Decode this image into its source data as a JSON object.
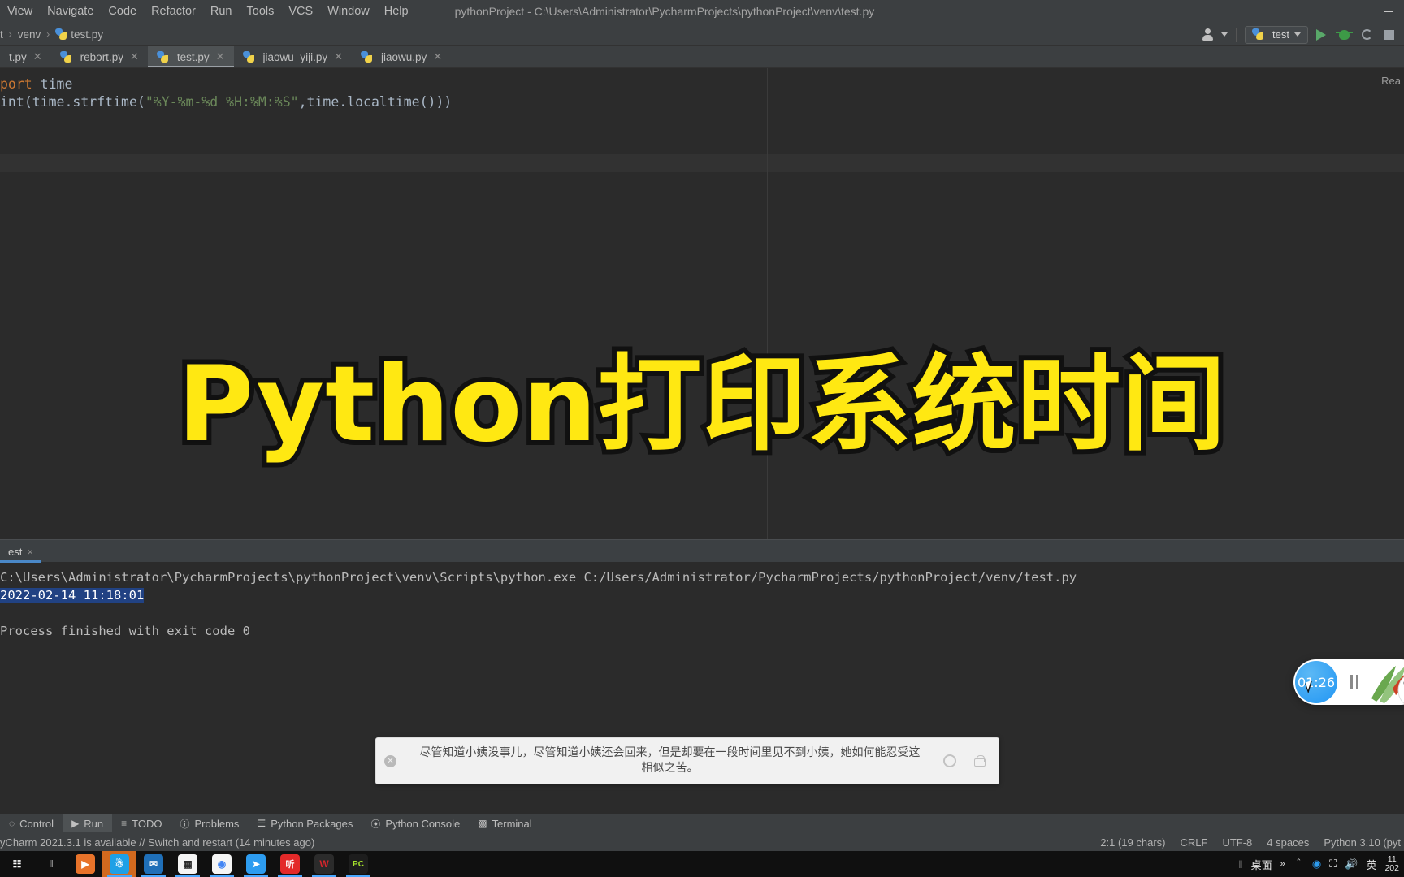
{
  "menubar": {
    "items": [
      "View",
      "Navigate",
      "Code",
      "Refactor",
      "Run",
      "Tools",
      "VCS",
      "Window",
      "Help"
    ],
    "window_title": "pythonProject - C:\\Users\\Administrator\\PycharmProjects\\pythonProject\\venv\\test.py"
  },
  "breadcrumb": {
    "project_fragment": "t",
    "folder": "venv",
    "file": "test.py",
    "separator": "›"
  },
  "toolbar": {
    "run_config_label": "test",
    "user_icon": "user-icon",
    "run_icon": "run-icon",
    "debug_icon": "debug-icon",
    "coverage_icon": "coverage-icon",
    "stop_icon": "stop-icon"
  },
  "tabs": [
    {
      "label": "t.py",
      "active": false
    },
    {
      "label": "rebort.py",
      "active": false
    },
    {
      "label": "test.py",
      "active": true
    },
    {
      "label": "jiaowu_yiji.py",
      "active": false
    },
    {
      "label": "jiaowu.py",
      "active": false
    }
  ],
  "editor": {
    "reader_mode_label": "Rea",
    "line1": {
      "kw": "port",
      "rest": " time"
    },
    "line2": {
      "fn": "int",
      "p1": "(",
      "a1": "time.strftime(",
      "str": "\"%Y-%m-%d %H:%M:%S\"",
      "a2": ",time.localtime()",
      "p2": "))"
    }
  },
  "overlay": {
    "title": "Python打印系统时间"
  },
  "run_window": {
    "tab_label": "est",
    "close_label": "×",
    "command_line": "C:\\Users\\Administrator\\PycharmProjects\\pythonProject\\venv\\Scripts\\python.exe C:/Users/Administrator/PycharmProjects/pythonProject/venv/test.py",
    "output_line": "2022-02-14 11:18:01",
    "exit_line": "Process finished with exit code 0"
  },
  "tool_strip": {
    "items": [
      {
        "label": "Control",
        "icon": "version-control-icon",
        "active": false
      },
      {
        "label": "Run",
        "icon": "run-icon",
        "active": true
      },
      {
        "label": "TODO",
        "icon": "todo-icon",
        "active": false
      },
      {
        "label": "Problems",
        "icon": "problems-icon",
        "active": false
      },
      {
        "label": "Python Packages",
        "icon": "packages-icon",
        "active": false
      },
      {
        "label": "Python Console",
        "icon": "python-console-icon",
        "active": false
      },
      {
        "label": "Terminal",
        "icon": "terminal-icon",
        "active": false
      }
    ]
  },
  "status_bar": {
    "message": "yCharm 2021.3.1 is available // Switch and restart (14 minutes ago)",
    "caret_position": "2:1 (19 chars)",
    "line_separator": "CRLF",
    "encoding": "UTF-8",
    "indent": "4 spaces",
    "interpreter": "Python 3.10 (pyt"
  },
  "ime_popup": {
    "text": "尽管知道小姨没事儿，尽管知道小姨还会回来，但是却要在一段时间里见不到小姨，她如何能忍受这相似之苦。",
    "close_label": "✕"
  },
  "timer_widget": {
    "time": "01:26"
  },
  "taskbar": {
    "items": [
      {
        "name": "task-view-icon",
        "glyph": "☰",
        "bg": "transparent",
        "fg": "#ffffff"
      },
      {
        "name": "divider-icon",
        "glyph": "‖",
        "bg": "transparent",
        "fg": "#888888"
      },
      {
        "name": "media-player-icon",
        "glyph": "▶",
        "bg": "#e8732a",
        "fg": "#ffffff"
      },
      {
        "name": "tim-icon",
        "glyph": "♅",
        "bg": "#1ea0e6",
        "fg": "#ffffff"
      },
      {
        "name": "mail-icon",
        "glyph": "✉",
        "bg": "#1f6fb8",
        "fg": "#ffffff"
      },
      {
        "name": "qrcode-icon",
        "glyph": "▒",
        "bg": "#f4f4f4",
        "fg": "#2a2a2a"
      },
      {
        "name": "chrome-icon",
        "glyph": "◉",
        "bg": "#f5f5f5",
        "fg": "#4285f4"
      },
      {
        "name": "dingtalk-icon",
        "glyph": "➤",
        "bg": "#2d9cf0",
        "fg": "#ffffff"
      },
      {
        "name": "ximalaya-icon",
        "glyph": "听",
        "bg": "#e32929",
        "fg": "#ffffff"
      },
      {
        "name": "wps-icon",
        "glyph": "W",
        "bg": "#2b2b2b",
        "fg": "#d8252c"
      },
      {
        "name": "pycharm-icon",
        "glyph": "PC",
        "bg": "#1d1d1d",
        "fg": "#a5e22d"
      }
    ],
    "tray": {
      "desktop_label": "桌面",
      "overflow_label": "»",
      "chevron_label": "＾",
      "network_icon": "network-icon",
      "display_icon": "display-icon",
      "volume_icon": "volume-icon",
      "ime_label": "英",
      "clock_time": "11",
      "clock_date": "202"
    }
  },
  "colors": {
    "bg_editor": "#2b2b2b",
    "bg_chrome": "#3c3f41",
    "accent_yellow": "#ffe812",
    "accent_blue": "#4a88c7",
    "selection_blue": "#214283",
    "run_green": "#59a869"
  }
}
